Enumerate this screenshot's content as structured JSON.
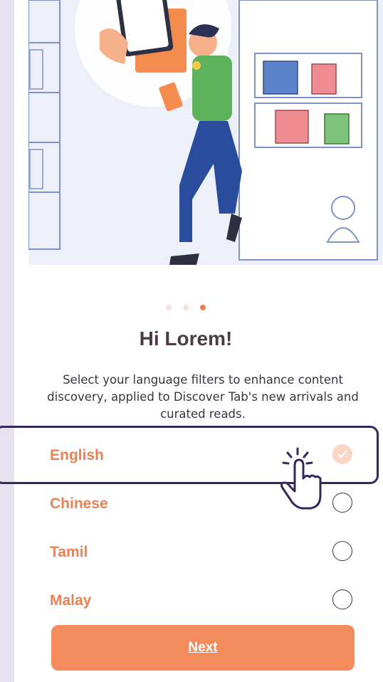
{
  "onboarding": {
    "title": "Hi Lorem!",
    "description": "Select your language filters to enhance content discovery, applied to Discover Tab's new arrivals and curated reads.",
    "pagination": {
      "total": 3,
      "active_index": 2
    },
    "languages": [
      {
        "label": "English",
        "selected": true
      },
      {
        "label": "Chinese",
        "selected": false
      },
      {
        "label": "Tamil",
        "selected": false
      },
      {
        "label": "Malay",
        "selected": false
      }
    ],
    "next_label": "Next"
  },
  "colors": {
    "accent": "#f48b5c",
    "label": "#ee8050",
    "title": "#4b3b44",
    "highlight": "#36285c",
    "checked_fill": "#f9d5c6"
  },
  "icons": {
    "hero": "person-reading-phone-illustration",
    "pointer": "tap-hand-icon",
    "check": "check-icon"
  }
}
